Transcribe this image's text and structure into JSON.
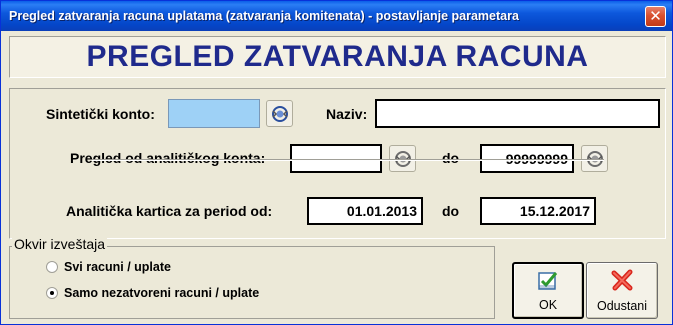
{
  "window": {
    "title": "Pregled zatvaranja racuna uplatama (zatvaranja komitenata) - postavljanje parametara",
    "close_label": "✕"
  },
  "header": {
    "title": "PREGLED ZATVARANJA RACUNA",
    "title_color": "#1f2a8c"
  },
  "params": {
    "sintetički_konto_label": "Sintetički konto:",
    "sintetički_konto_value": "",
    "naziv_label": "Naziv:",
    "naziv_value": "",
    "pregled_label": "Pregled od analitičkog konta:",
    "pregled_od_value": "",
    "do_label": "do",
    "pregled_do_value": "99999999",
    "kartica_label": "Analitička kartica za period od:",
    "kartica_od_value": "01.01.2013",
    "kartica_do_label": "do",
    "kartica_do_value": "15.12.2017",
    "lookup_icon": "lookup-icon",
    "cyan_field_color": "#9ed1f6"
  },
  "options": {
    "legend": "Okvir izveštaja",
    "items": [
      {
        "label": "Svi racuni / uplate",
        "selected": false
      },
      {
        "label": "Samo nezatvoreni racuni / uplate",
        "selected": true
      }
    ]
  },
  "buttons": {
    "ok_label": "OK",
    "ok_icon": "checkbox-check-icon",
    "cancel_label": "Odustani",
    "cancel_icon": "red-x-icon"
  }
}
